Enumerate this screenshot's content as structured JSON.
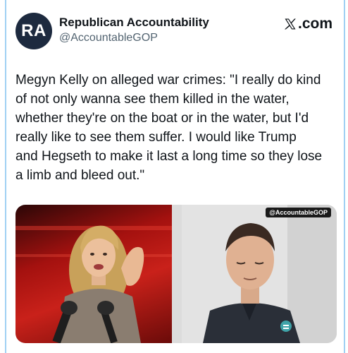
{
  "account": {
    "avatar_initials": "RA",
    "display_name": "Republican Accountability",
    "handle": "@AccountableGOP"
  },
  "header": {
    "brand_label": ".com",
    "brand_icon": "x-logo-icon"
  },
  "tweet": {
    "text_lines": [
      "Megyn Kelly on alleged war crimes: \"I really do kind",
      "of not only wanna see them killed in the water,",
      "whether they're on the boat or in the water, but I'd",
      "really like to see them suffer. I would like Trump",
      "and Hegseth to make it last a long time so they lose",
      "a limb and bleed out.\""
    ]
  },
  "media": {
    "watermark": "@AccountableGOP"
  },
  "colors": {
    "frame_border": "#9fd0f3",
    "avatar_bg": "#1d2a3f",
    "text_primary": "#0f1419",
    "text_secondary": "#536471"
  }
}
